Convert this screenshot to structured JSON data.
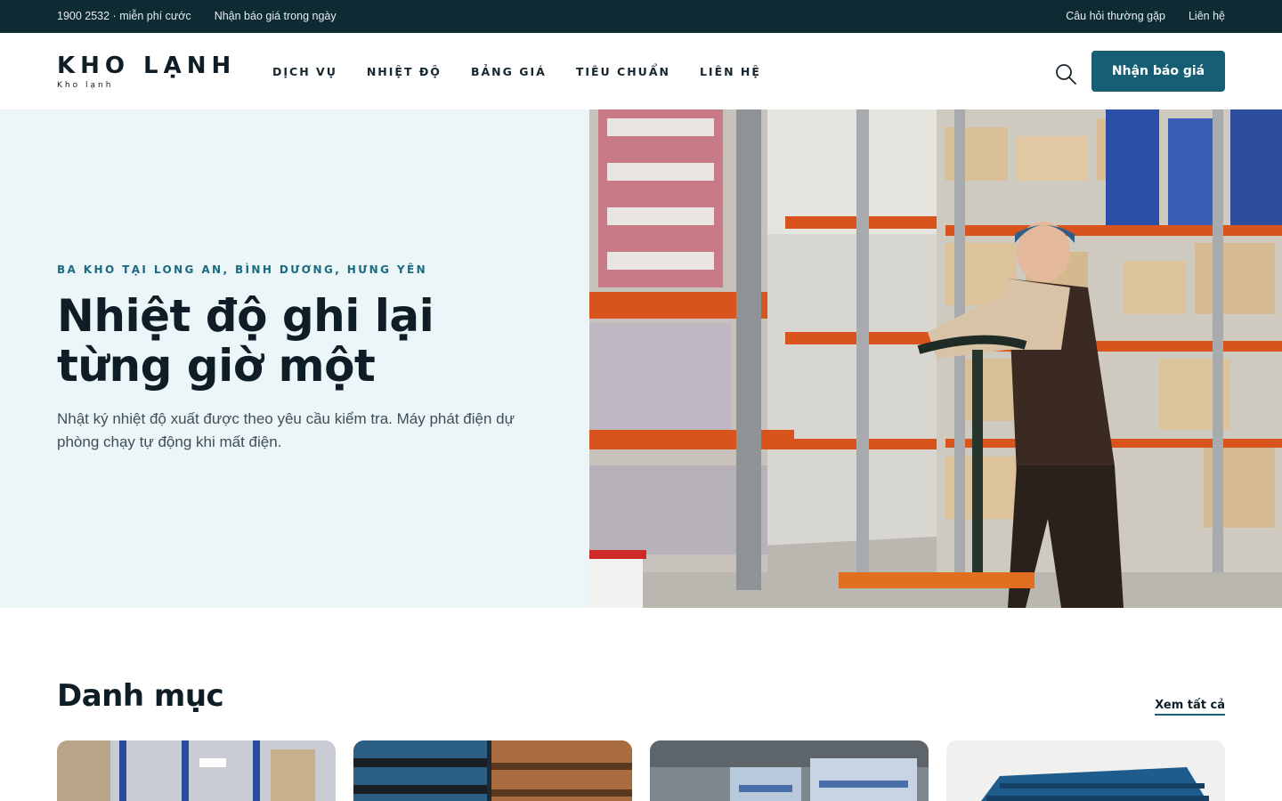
{
  "topbar": {
    "phone": "1900 2532 · miễn phí cước",
    "quote_note": "Nhận báo giá trong ngày",
    "faq_link": "Câu hỏi thường gặp",
    "contact_link": "Liên hệ"
  },
  "header": {
    "logo_title": "KHO LẠNH",
    "logo_subtitle": "Kho lạnh",
    "nav": [
      "DỊCH VỤ",
      "NHIỆT ĐỘ",
      "BẢNG GIÁ",
      "TIÊU CHUẨN",
      "LIÊN HỆ"
    ],
    "search_icon": "search-icon",
    "cta_label": "Nhận báo giá"
  },
  "hero": {
    "eyebrow": "BA KHO TẠI LONG AN, BÌNH DƯƠNG, HƯNG YÊN",
    "title_line1": "Nhiệt độ ghi lại",
    "title_line2": "từng giờ một",
    "description": "Nhật ký nhiệt độ xuất được theo yêu cầu kiểm tra. Máy phát điện dự phòng chạy tự động khi mất điện."
  },
  "categories": {
    "title": "Danh mục",
    "see_all": "Xem tất cả"
  },
  "colors": {
    "topbar_bg": "#0e2a33",
    "accent": "#155e73",
    "hero_bg": "#ecf6f8",
    "text_dark": "#0f1e26"
  }
}
